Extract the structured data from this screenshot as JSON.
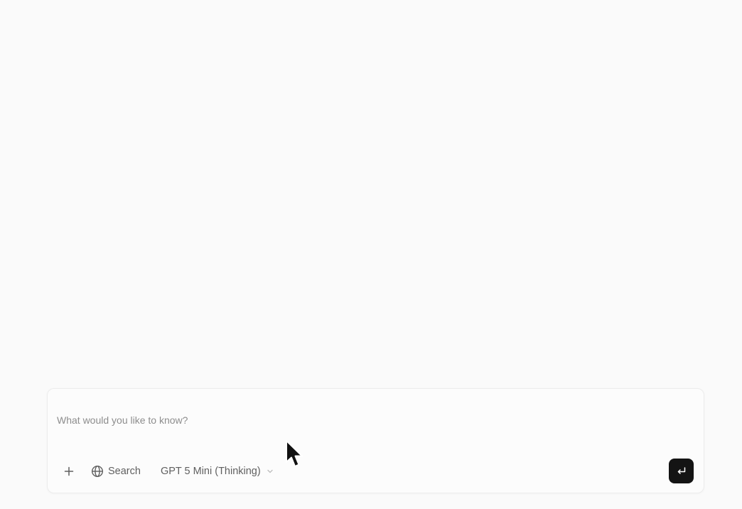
{
  "composer": {
    "placeholder": "What would you like to know?",
    "value": "",
    "toolbar": {
      "add_icon": "plus-icon",
      "search_icon": "globe-icon",
      "search_label": "Search",
      "model_label": "GPT 5 Mini (Thinking)",
      "model_chevron_icon": "chevron-down-icon",
      "submit_icon": "enter-return-icon"
    }
  },
  "colors": {
    "background": "#fafafa",
    "composer_border": "#ececec",
    "text_muted": "#5f5f5f",
    "placeholder": "#8d8d8d",
    "submit_background": "#141414",
    "submit_icon": "#ffffff"
  }
}
